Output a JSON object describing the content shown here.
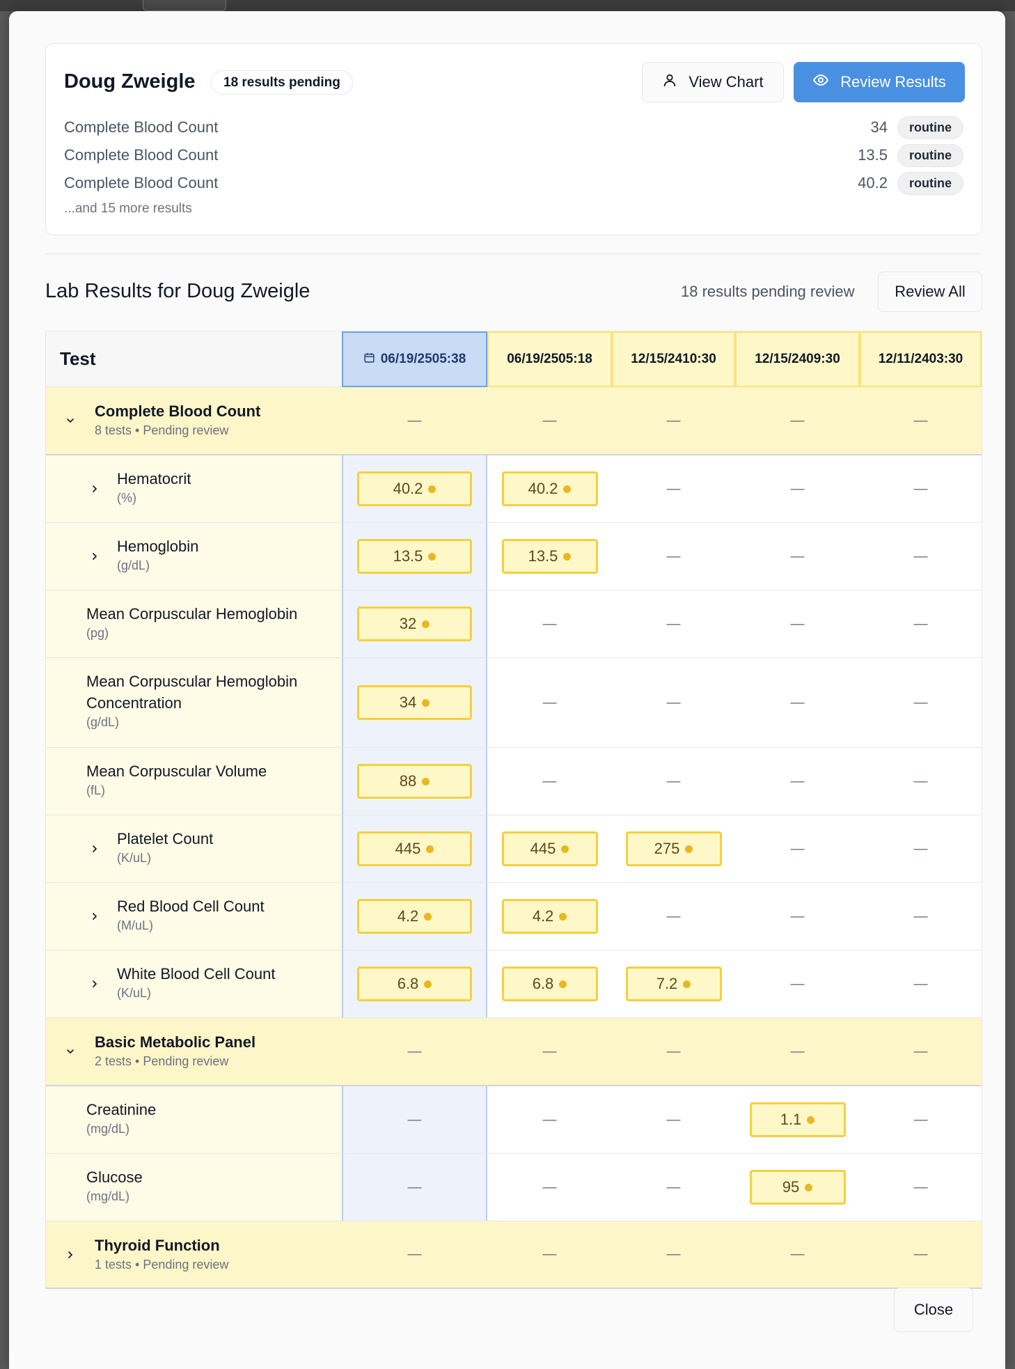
{
  "patient": {
    "name": "Doug Zweigle",
    "pending_badge": "18 results pending"
  },
  "actions": {
    "view_chart": "View Chart",
    "review_results": "Review Results",
    "review_all": "Review All",
    "close": "Close"
  },
  "summary": {
    "rows": [
      {
        "label": "Complete Blood Count",
        "value": "34",
        "priority": "routine"
      },
      {
        "label": "Complete Blood Count",
        "value": "13.5",
        "priority": "routine"
      },
      {
        "label": "Complete Blood Count",
        "value": "40.2",
        "priority": "routine"
      }
    ],
    "more": "...and 15 more results"
  },
  "section": {
    "title": "Lab Results for Doug Zweigle",
    "pending_text": "18 results pending review"
  },
  "table": {
    "test_header": "Test",
    "dates": [
      "06/19/2505:38",
      "06/19/2505:18",
      "12/15/2410:30",
      "12/15/2409:30",
      "12/11/2403:30"
    ],
    "selected_date_index": 0,
    "dash": "—",
    "groups": [
      {
        "name": "Complete Blood Count",
        "sub": "8 tests • Pending review",
        "expanded": true
      },
      {
        "name": "Basic Metabolic Panel",
        "sub": "2 tests • Pending review",
        "expanded": true
      },
      {
        "name": "Thyroid Function",
        "sub": "1 tests • Pending review",
        "expanded": false
      }
    ],
    "tests": [
      {
        "name": "Hematocrit",
        "unit": "(%)",
        "values": [
          "40.2",
          "40.2",
          null,
          null,
          null
        ]
      },
      {
        "name": "Hemoglobin",
        "unit": "(g/dL)",
        "values": [
          "13.5",
          "13.5",
          null,
          null,
          null
        ]
      },
      {
        "name": "Mean Corpuscular Hemoglobin",
        "unit": "(pg)",
        "values": [
          "32",
          null,
          null,
          null,
          null
        ]
      },
      {
        "name": "Mean Corpuscular Hemoglobin Concentration",
        "unit": "(g/dL)",
        "values": [
          "34",
          null,
          null,
          null,
          null
        ]
      },
      {
        "name": "Mean Corpuscular Volume",
        "unit": "(fL)",
        "values": [
          "88",
          null,
          null,
          null,
          null
        ]
      },
      {
        "name": "Platelet Count",
        "unit": "(K/uL)",
        "values": [
          "445",
          "445",
          "275",
          null,
          null
        ]
      },
      {
        "name": "Red Blood Cell Count",
        "unit": "(M/uL)",
        "values": [
          "4.2",
          "4.2",
          null,
          null,
          null
        ]
      },
      {
        "name": "White Blood Cell Count",
        "unit": "(K/uL)",
        "values": [
          "6.8",
          "6.8",
          "7.2",
          null,
          null
        ]
      },
      {
        "name": "Creatinine",
        "unit": "(mg/dL)",
        "values": [
          null,
          null,
          null,
          "1.1",
          null
        ]
      },
      {
        "name": "Glucose",
        "unit": "(mg/dL)",
        "values": [
          null,
          null,
          null,
          "95",
          null
        ]
      }
    ]
  },
  "icons": {
    "user": "user-icon",
    "eye": "eye-icon",
    "calendar": "calendar-icon",
    "chevron_down": "chevron-down-icon",
    "chevron_right": "chevron-right-icon",
    "status_dot": "pending-dot-icon"
  },
  "colors": {
    "primary": "#4a90e2",
    "pending_fill": "#fef7c8",
    "pending_border": "#f4d03f",
    "dot": "#e6b923",
    "group_bg": "#fdf6c8",
    "selected_col": "#c8dcf5"
  }
}
